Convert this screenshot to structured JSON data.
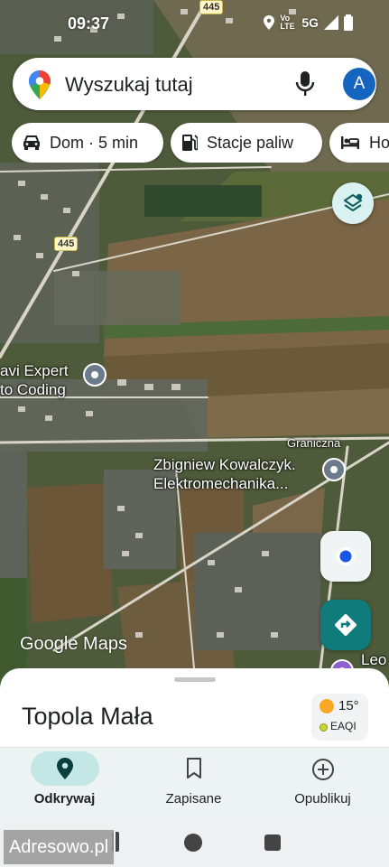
{
  "status_bar": {
    "time": "09:37",
    "network": "5G",
    "volte": "Vo LTE",
    "icons": [
      "location-icon",
      "signal-icon",
      "battery-icon"
    ]
  },
  "search": {
    "placeholder": "Wyszukaj tutaj",
    "avatar_letter": "A",
    "icons": [
      "maps-pin-icon",
      "mic-icon"
    ]
  },
  "chips": [
    {
      "label": "Dom · 5 min",
      "icon": "car-icon"
    },
    {
      "label": "Stacje paliw",
      "icon": "gas-station-icon"
    },
    {
      "label": "Ho",
      "icon": "hotel-icon"
    }
  ],
  "map": {
    "road_shields": [
      "445",
      "445"
    ],
    "labels": {
      "poi1_line1": "avi Expert",
      "poi1_line2": "to Coding",
      "street": "Graniczna",
      "poi2_line1": "Zbigniew Kowalczyk.",
      "poi2_line2": "Elektromechanika...",
      "edge_label": "Leo"
    },
    "logo": "Google Maps",
    "colors": {
      "fields": "#6b5a3e",
      "grass": "#4f5f33",
      "roads": "#d8d4c8"
    }
  },
  "controls": {
    "icons": [
      "layers-icon",
      "my-location-icon",
      "directions-icon"
    ],
    "accent": "#0f7b7b"
  },
  "sheet": {
    "place_name": "Topola Mała",
    "weather": {
      "temp": "15°",
      "aqi_label": "EAQI"
    }
  },
  "bottom_nav": {
    "items": [
      {
        "label": "Odkrywaj",
        "icon": "explore-pin-icon",
        "active": true
      },
      {
        "label": "Zapisane",
        "icon": "bookmark-icon",
        "active": false
      },
      {
        "label": "Opublikuj",
        "icon": "add-circle-icon",
        "active": false
      }
    ]
  },
  "watermark": "Adresowo.pl"
}
